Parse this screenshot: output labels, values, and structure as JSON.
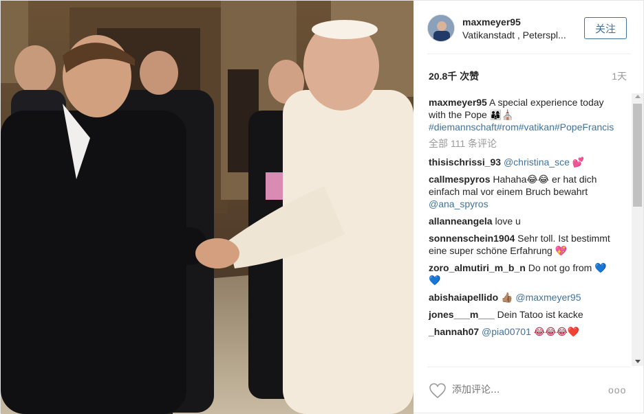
{
  "post": {
    "username": "maxmeyer95",
    "location": "Vatikanstadt , Peterspl...",
    "follow_label": "关注",
    "likes": "20.8千 次赞",
    "time": "1天",
    "caption": {
      "user": "maxmeyer95",
      "text": "A special experience today with the Pope 👨‍👩‍👦⛪",
      "hashtags": "#diemannschaft#rom#vatikan#PopeFrancis"
    },
    "view_all": "全部 111 条评论",
    "comments": [
      {
        "user": "thisischrissi_93",
        "mention": "@christina_sce",
        "text": "",
        "emoji": "💕"
      },
      {
        "user": "callmespyros",
        "mention": "",
        "text": "Hahaha😂😂 er hat dich einfach mal vor einem Bruch bewahrt",
        "mention_after": "@ana_spyros",
        "emoji": ""
      },
      {
        "user": "allanneangela",
        "mention": "",
        "text": "love u",
        "emoji": ""
      },
      {
        "user": "sonnenschein1904",
        "mention": "",
        "text": "Sehr toll. Ist bestimmt eine super schöne Erfahrung",
        "emoji": "💖"
      },
      {
        "user": "zoro_almutiri_m_b_n",
        "mention": "",
        "text": "Do not go from",
        "emoji": "💙 💙"
      },
      {
        "user": "abishaiapellido",
        "mention": "@maxmeyer95",
        "text": "",
        "emoji_before": "👍🏽"
      },
      {
        "user": "jones___m___",
        "mention": "",
        "text": "Dein Tatoo ist kacke",
        "emoji": ""
      },
      {
        "user": "_hannah07",
        "mention": "@pia00701",
        "text": "",
        "emoji": "😂😂😂❤️"
      }
    ],
    "add_comment_placeholder": "添加评论...",
    "more_label": "ooo"
  },
  "colors": {
    "link": "#3f729b",
    "muted": "#999999",
    "text": "#262626"
  },
  "icons": [
    "heart-icon",
    "more-options-icon",
    "scroll-up-arrow",
    "scroll-down-arrow"
  ]
}
